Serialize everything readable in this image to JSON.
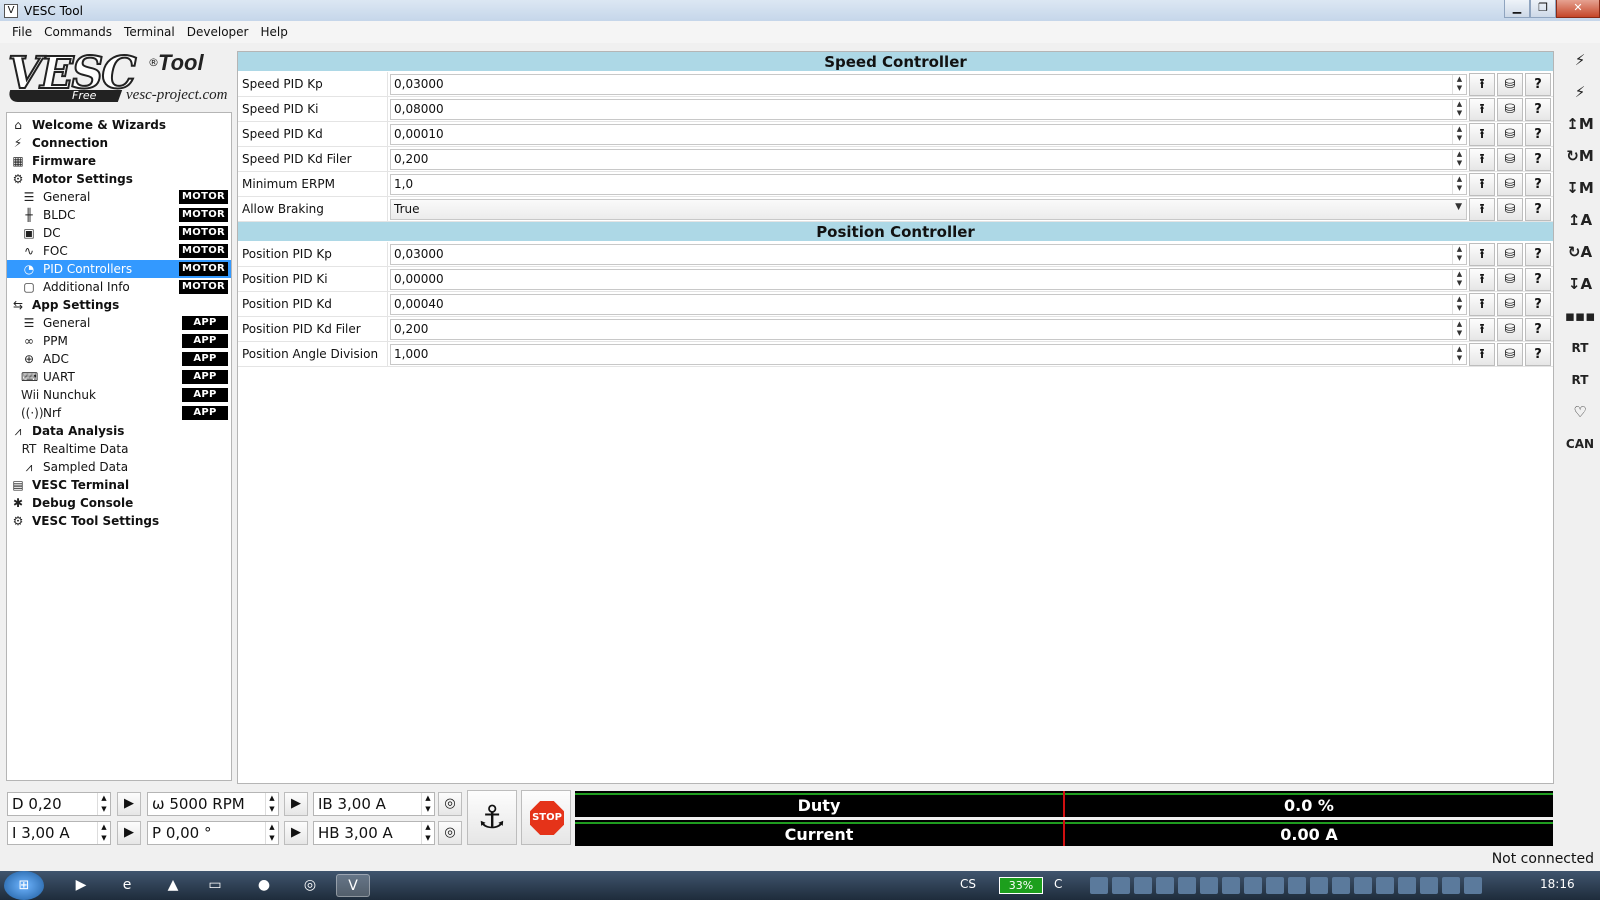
{
  "window": {
    "title": "VESC Tool"
  },
  "menu": [
    "File",
    "Commands",
    "Terminal",
    "Developer",
    "Help"
  ],
  "logo": {
    "brand": "VESC",
    "tool": "Tool",
    "reg": "®",
    "edition": "Free",
    "site": "vesc-project.com"
  },
  "tree": [
    {
      "label": "Welcome & Wizards",
      "level": "top",
      "icon": "home-icon",
      "glyph": "⌂"
    },
    {
      "label": "Connection",
      "level": "top",
      "icon": "plug-icon",
      "glyph": "⚡"
    },
    {
      "label": "Firmware",
      "level": "top",
      "icon": "chip-icon",
      "glyph": "▦"
    },
    {
      "label": "Motor Settings",
      "level": "top",
      "icon": "motor-icon",
      "glyph": "⚙"
    },
    {
      "label": "General",
      "level": "child",
      "icon": "sliders-icon",
      "glyph": "☰",
      "badge": "MOTOR"
    },
    {
      "label": "BLDC",
      "level": "child",
      "icon": "bldc-icon",
      "glyph": "╫",
      "badge": "MOTOR"
    },
    {
      "label": "DC",
      "level": "child",
      "icon": "dc-motor-icon",
      "glyph": "▣",
      "badge": "MOTOR"
    },
    {
      "label": "FOC",
      "level": "child",
      "icon": "foc-icon",
      "glyph": "∿",
      "badge": "MOTOR"
    },
    {
      "label": "PID Controllers",
      "level": "child",
      "icon": "gauge-icon",
      "glyph": "◔",
      "badge": "MOTOR",
      "selected": true
    },
    {
      "label": "Additional Info",
      "level": "child",
      "icon": "info-icon",
      "glyph": "▢",
      "badge": "MOTOR"
    },
    {
      "label": "App Settings",
      "level": "top",
      "icon": "app-settings-icon",
      "glyph": "⇆"
    },
    {
      "label": "General",
      "level": "child",
      "icon": "sliders-icon",
      "glyph": "☰",
      "badge": "APP"
    },
    {
      "label": "PPM",
      "level": "child",
      "icon": "gamepad-icon",
      "glyph": "∞",
      "badge": "APP"
    },
    {
      "label": "ADC",
      "level": "child",
      "icon": "adc-icon",
      "glyph": "⊕",
      "badge": "APP"
    },
    {
      "label": "UART",
      "level": "child",
      "icon": "keyboard-icon",
      "glyph": "⌨",
      "badge": "APP"
    },
    {
      "label": "Nunchuk",
      "level": "child",
      "icon": "wii-icon",
      "glyph": "Wii",
      "badge": "APP"
    },
    {
      "label": "Nrf",
      "level": "child",
      "icon": "wireless-icon",
      "glyph": "((·))",
      "badge": "APP"
    },
    {
      "label": "Data Analysis",
      "level": "top",
      "icon": "chart-icon",
      "glyph": "⩘"
    },
    {
      "label": "Realtime Data",
      "level": "child",
      "icon": "realtime-icon",
      "glyph": "RT"
    },
    {
      "label": "Sampled Data",
      "level": "child",
      "icon": "sampled-icon",
      "glyph": "⩘"
    },
    {
      "label": "VESC Terminal",
      "level": "top",
      "icon": "terminal-icon",
      "glyph": "▤"
    },
    {
      "label": "Debug Console",
      "level": "top",
      "icon": "bug-icon",
      "glyph": "✱"
    },
    {
      "label": "VESC Tool Settings",
      "level": "top",
      "icon": "gear-icon",
      "glyph": "⚙"
    }
  ],
  "sections": [
    {
      "title": "Speed Controller",
      "rows": [
        {
          "label": "Speed PID Kp",
          "value": "0,03000",
          "type": "spin"
        },
        {
          "label": "Speed PID Ki",
          "value": "0,08000",
          "type": "spin"
        },
        {
          "label": "Speed PID Kd",
          "value": "0,00010",
          "type": "spin"
        },
        {
          "label": "Speed PID Kd Filer",
          "value": "0,200",
          "type": "spin"
        },
        {
          "label": "Minimum ERPM",
          "value": "1,0",
          "type": "spin"
        },
        {
          "label": "Allow Braking",
          "value": "True",
          "type": "select"
        }
      ]
    },
    {
      "title": "Position Controller",
      "rows": [
        {
          "label": "Position PID Kp",
          "value": "0,03000",
          "type": "spin"
        },
        {
          "label": "Position PID Ki",
          "value": "0,00000",
          "type": "spin"
        },
        {
          "label": "Position PID Kd",
          "value": "0,00040",
          "type": "spin"
        },
        {
          "label": "Position PID Kd Filer",
          "value": "0,200",
          "type": "spin"
        },
        {
          "label": "Position Angle Division",
          "value": "1,000",
          "type": "spin"
        }
      ]
    }
  ],
  "row_buttons": [
    "upload-icon",
    "database-icon",
    "help-icon"
  ],
  "right_toolbar": [
    {
      "icon": "connect-icon",
      "glyph": "⚡"
    },
    {
      "icon": "disconnect-icon",
      "glyph": "⚡"
    },
    {
      "icon": "read-motor-icon",
      "glyph": "↥M"
    },
    {
      "icon": "default-motor-icon",
      "glyph": "↻M"
    },
    {
      "icon": "write-motor-icon",
      "glyph": "↧M"
    },
    {
      "icon": "read-app-icon",
      "glyph": "↥A"
    },
    {
      "icon": "default-app-icon",
      "glyph": "↻A"
    },
    {
      "icon": "write-app-icon",
      "glyph": "↧A"
    },
    {
      "icon": "can-fwd-icon",
      "glyph": "▪▪▪"
    },
    {
      "icon": "rt-data-icon",
      "glyph": "RT"
    },
    {
      "icon": "rt-app-icon",
      "glyph": "RT"
    },
    {
      "icon": "heart-icon",
      "glyph": "♡"
    },
    {
      "icon": "can-icon",
      "glyph": "CAN"
    }
  ],
  "controls": {
    "duty": "D 0,20",
    "rpm": "ω 5000 RPM",
    "ib": "IB 3,00 A",
    "current": "I 3,00 A",
    "position": "P 0,00 °",
    "hb": "HB 3,00 A",
    "stop_label": "STOP"
  },
  "meters": [
    {
      "label": "Duty",
      "value": "0.0 %"
    },
    {
      "label": "Current",
      "value": "0.00 A"
    }
  ],
  "status": "Not connected",
  "taskbar": {
    "lang": "CS",
    "battery": "33%",
    "time": "18:16"
  }
}
